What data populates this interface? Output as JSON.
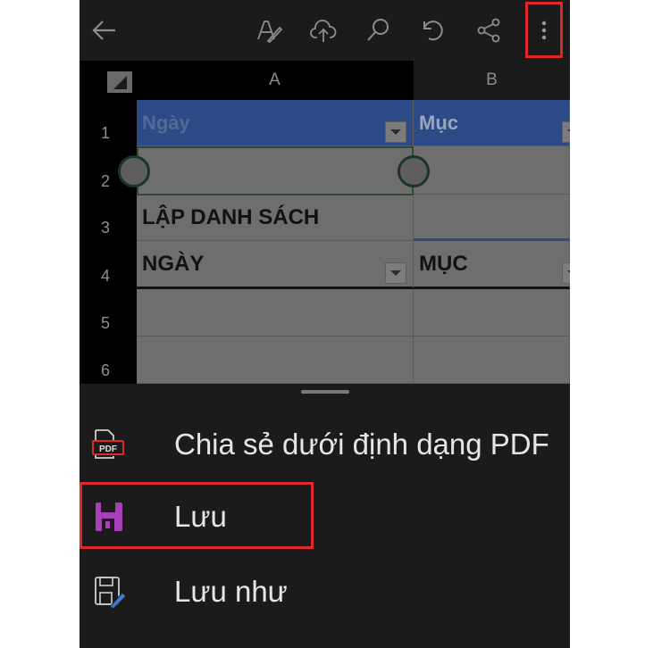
{
  "toolbar": {
    "icons": [
      "back-arrow-icon",
      "pen-icon",
      "cloud-upload-icon",
      "search-icon",
      "undo-icon",
      "share-icon",
      "more-vertical-icon"
    ],
    "highlight_color": "#e0282b"
  },
  "sheet": {
    "columns": [
      "A",
      "B"
    ],
    "rows": [
      "1",
      "2",
      "3",
      "4",
      "5",
      "6"
    ],
    "cells": {
      "a1": "Ngày",
      "b1": "Mục",
      "a3": "LẬP DANH SÁCH",
      "a4": "NGÀY",
      "b4": "MỤC"
    },
    "header_fill": "#2b4a86"
  },
  "menu": {
    "items": [
      {
        "label": "Chia sẻ dưới định dạng PDF",
        "icon": "pdf-icon"
      },
      {
        "label": "Lưu",
        "icon": "floppy-disk-icon"
      },
      {
        "label": "Lưu như",
        "icon": "save-as-icon"
      }
    ]
  }
}
